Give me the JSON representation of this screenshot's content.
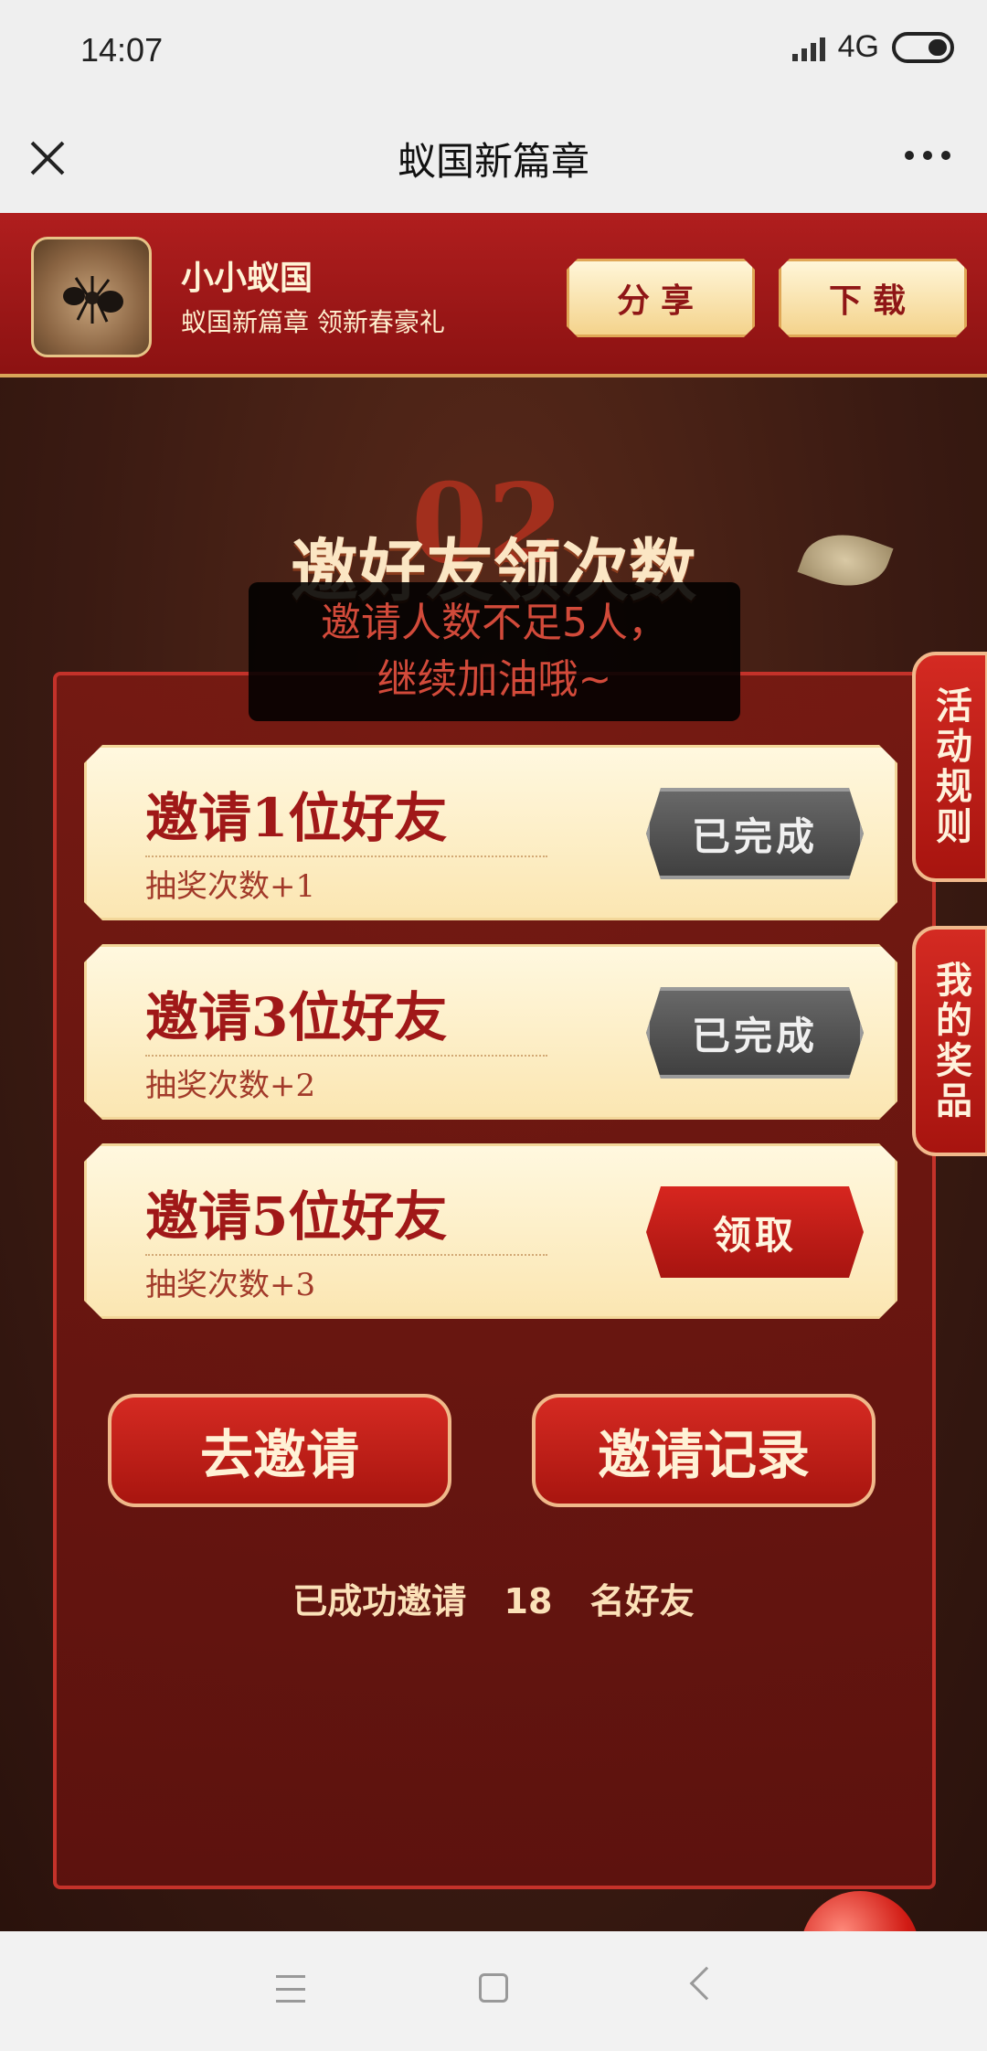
{
  "status_bar": {
    "time": "14:07",
    "network": "4G"
  },
  "title_bar": {
    "title": "蚁国新篇章"
  },
  "app": {
    "name": "小小蚁国",
    "subtitle": "蚁国新篇章 领新春豪礼",
    "share_label": "分享",
    "download_label": "下载"
  },
  "section": {
    "number": "02",
    "title": "邀好友领次数"
  },
  "toast": {
    "line1": "邀请人数不足5人，",
    "line2": "继续加油哦~"
  },
  "tasks": [
    {
      "title": "邀请1位好友",
      "reward": "抽奖次数+1",
      "button": "已完成",
      "state": "done"
    },
    {
      "title": "邀请3位好友",
      "reward": "抽奖次数+2",
      "button": "已完成",
      "state": "done"
    },
    {
      "title": "邀请5位好友",
      "reward": "抽奖次数+3",
      "button": "领取",
      "state": "claim"
    }
  ],
  "actions": {
    "invite": "去邀请",
    "records": "邀请记录"
  },
  "invited": {
    "prefix": "已成功邀请",
    "count": "18",
    "suffix": "名好友"
  },
  "side_tabs": {
    "rules": "活动规则",
    "prizes": "我的奖品"
  }
}
